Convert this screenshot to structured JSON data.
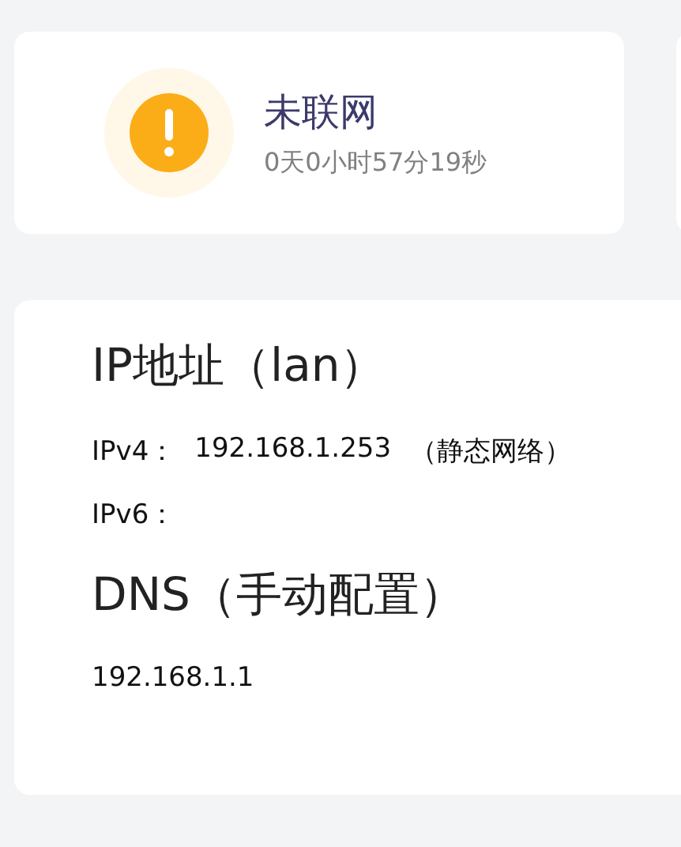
{
  "status_card": {
    "kind": "warning",
    "title": "未联网",
    "uptime": "0天0小时57分19秒"
  },
  "ip_section": {
    "heading": "IP地址（lan）",
    "rows": [
      {
        "label": "IPv4：",
        "value": "192.168.1.253",
        "note": "（静态网络）"
      },
      {
        "label": "IPv6："
      }
    ]
  },
  "dns_section": {
    "heading": "DNS（手动配置）",
    "servers": [
      "192.168.1.1"
    ]
  }
}
